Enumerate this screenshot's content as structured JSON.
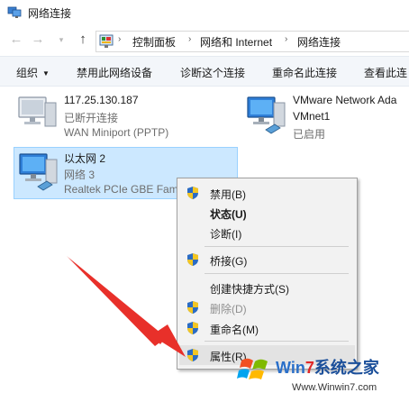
{
  "window": {
    "title": "网络连接"
  },
  "nav": {
    "back_icon": "back-arrow-icon",
    "forward_icon": "forward-arrow-icon",
    "recent_icon": "chevron-down-icon",
    "up_icon": "up-arrow-icon"
  },
  "breadcrumb": [
    "控制面板",
    "网络和 Internet",
    "网络连接"
  ],
  "commands": {
    "organize": "组织",
    "disable": "禁用此网络设备",
    "diagnose": "诊断这个连接",
    "rename": "重命名此连接",
    "view": "查看此连"
  },
  "connections": [
    {
      "name": "117.25.130.187",
      "status": "已断开连接",
      "device": "WAN Miniport (PPTP)"
    },
    {
      "name": "VMware Network Ada",
      "status": "VMnet1",
      "device": "已启用"
    },
    {
      "name": "以太网 2",
      "status": "网络 3",
      "device": "Realtek PCIe GBE Fam"
    }
  ],
  "context_menu": [
    {
      "label": "禁用(B)",
      "shield": true
    },
    {
      "label": "状态(U)",
      "bold": true
    },
    {
      "label": "诊断(I)"
    },
    {
      "label": "桥接(G)",
      "shield": true
    },
    {
      "label": "创建快捷方式(S)"
    },
    {
      "label": "删除(D)",
      "shield": true,
      "disabled": true
    },
    {
      "label": "重命名(M)",
      "shield": true
    },
    {
      "label": "属性(R)",
      "shield": true,
      "highlighted": true
    }
  ],
  "watermark": {
    "brand_prefix": "Win",
    "brand_number": "7",
    "brand_suffix": "系统之家",
    "url": "Www.Winwin7.com"
  },
  "colors": {
    "selection": "#cce8ff",
    "arrow": "#e8302a",
    "menu_bg": "#f2f2f2",
    "cmdbar_bg": "#f3f6fa"
  }
}
